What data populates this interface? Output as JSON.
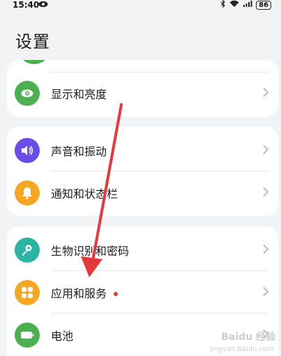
{
  "status_bar": {
    "time": "15:40",
    "battery": "86"
  },
  "page": {
    "title": "设置"
  },
  "groups": [
    {
      "items": [
        {
          "label": "显示和亮度",
          "icon": "eye-icon",
          "color": "#4caf50"
        }
      ]
    },
    {
      "items": [
        {
          "label": "声音和振动",
          "icon": "speaker-icon",
          "color": "#6a4de8"
        },
        {
          "label": "通知和状态栏",
          "icon": "bell-icon",
          "color": "#f5a623"
        }
      ]
    },
    {
      "items": [
        {
          "label": "生物识别和密码",
          "icon": "key-icon",
          "color": "#2bb3a3"
        },
        {
          "label": "应用和服务",
          "icon": "apps-icon",
          "color": "#f5a623",
          "badge": true
        },
        {
          "label": "电池",
          "icon": "battery-icon",
          "color": "#4caf50"
        }
      ]
    }
  ],
  "overlay": {
    "arrow_color": "#e5383b",
    "watermark": "Baidu 经验",
    "watermark_sub": "jingyan.baidu.com"
  }
}
